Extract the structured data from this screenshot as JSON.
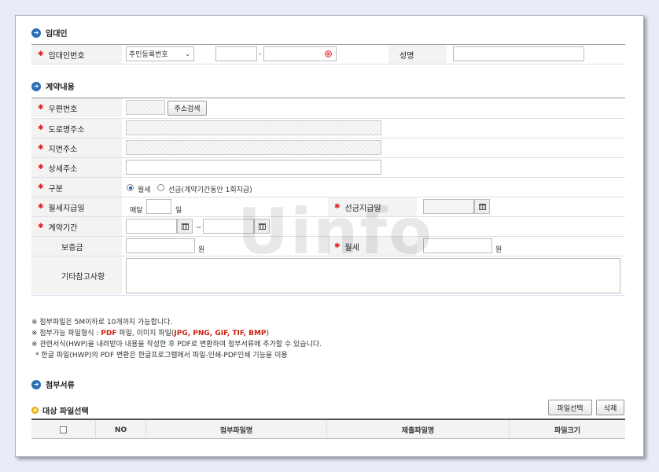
{
  "sections": {
    "landlord": "임대인",
    "contract": "계약내용",
    "attachments": "첨부서류"
  },
  "landlord": {
    "id_label": "임대인번호",
    "id_type_selected": "주민등록번호",
    "separator": "-",
    "name_label": "성명"
  },
  "contract": {
    "zipcode_label": "우편번호",
    "address_search_button": "주소검색",
    "road_address_label": "도로명주소",
    "lot_address_label": "지번주소",
    "detail_address_label": "상세주소",
    "type_label": "구분",
    "type_options": [
      "월세",
      "선금(계약기간동안 1회지급)"
    ],
    "monthly_payday_label": "월세지급일",
    "monthly_prefix": "매달",
    "monthly_suffix": "일",
    "prepay_date_label": "선금지급일",
    "period_label": "계약기간",
    "period_separator": "~",
    "deposit_label": "보증금",
    "won": "원",
    "rent_label": "월세",
    "notes_label": "기타참고사항"
  },
  "notes": {
    "line1": "※ 첨부파일은 5M이하로 10개까지 가능합니다.",
    "line2_prefix": "※ 첨부가능 파일형식 : ",
    "line2_pdf": "PDF",
    "line2_mid": " 파일, 이미지 파일(",
    "line2_img": "JPG, PNG, GIF, TIF, BMP",
    "line2_suffix": ")",
    "line3": "※ 관련서식(HWP)을 내려받아 내용을 작성한 후 PDF로 변환하여 첨부서류에 추가할 수 있습니다.",
    "line4": "* 한글 파일(HWP)의 PDF 변환은 한글프로그램에서 파일-인쇄-PDF인쇄 기능을 이용"
  },
  "files": {
    "target_label": "대상 파일선택",
    "select_button": "파일선택",
    "delete_button": "삭제",
    "columns": [
      "NO",
      "첨부파일명",
      "제출파일명",
      "파일크기"
    ]
  },
  "watermark": "Uinfo",
  "colors": {
    "accent": "#2a6fb5",
    "required": "#d22222"
  }
}
